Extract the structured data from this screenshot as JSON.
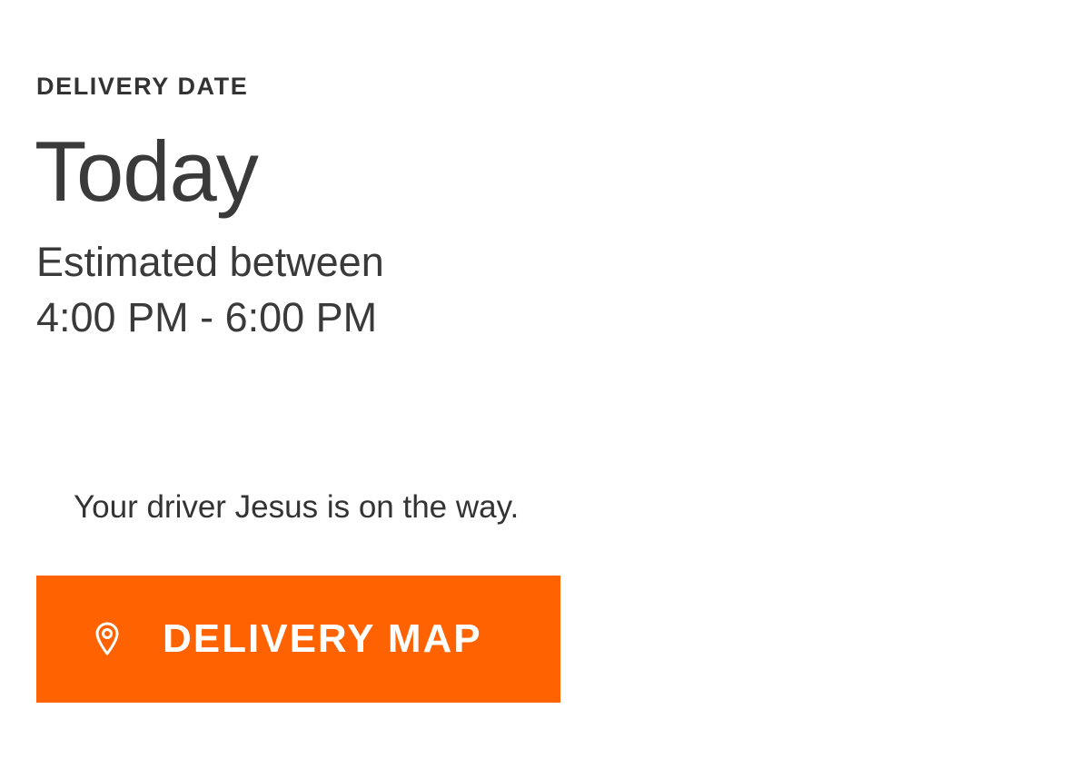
{
  "delivery": {
    "section_label": "DELIVERY DATE",
    "day": "Today",
    "estimate_line1": "Estimated between",
    "estimate_line2": "4:00 PM - 6:00 PM"
  },
  "driver": {
    "message": "Your driver Jesus is on the way."
  },
  "map_button": {
    "label": "DELIVERY MAP",
    "icon": "location-pin-icon",
    "color": "#ff6200"
  }
}
